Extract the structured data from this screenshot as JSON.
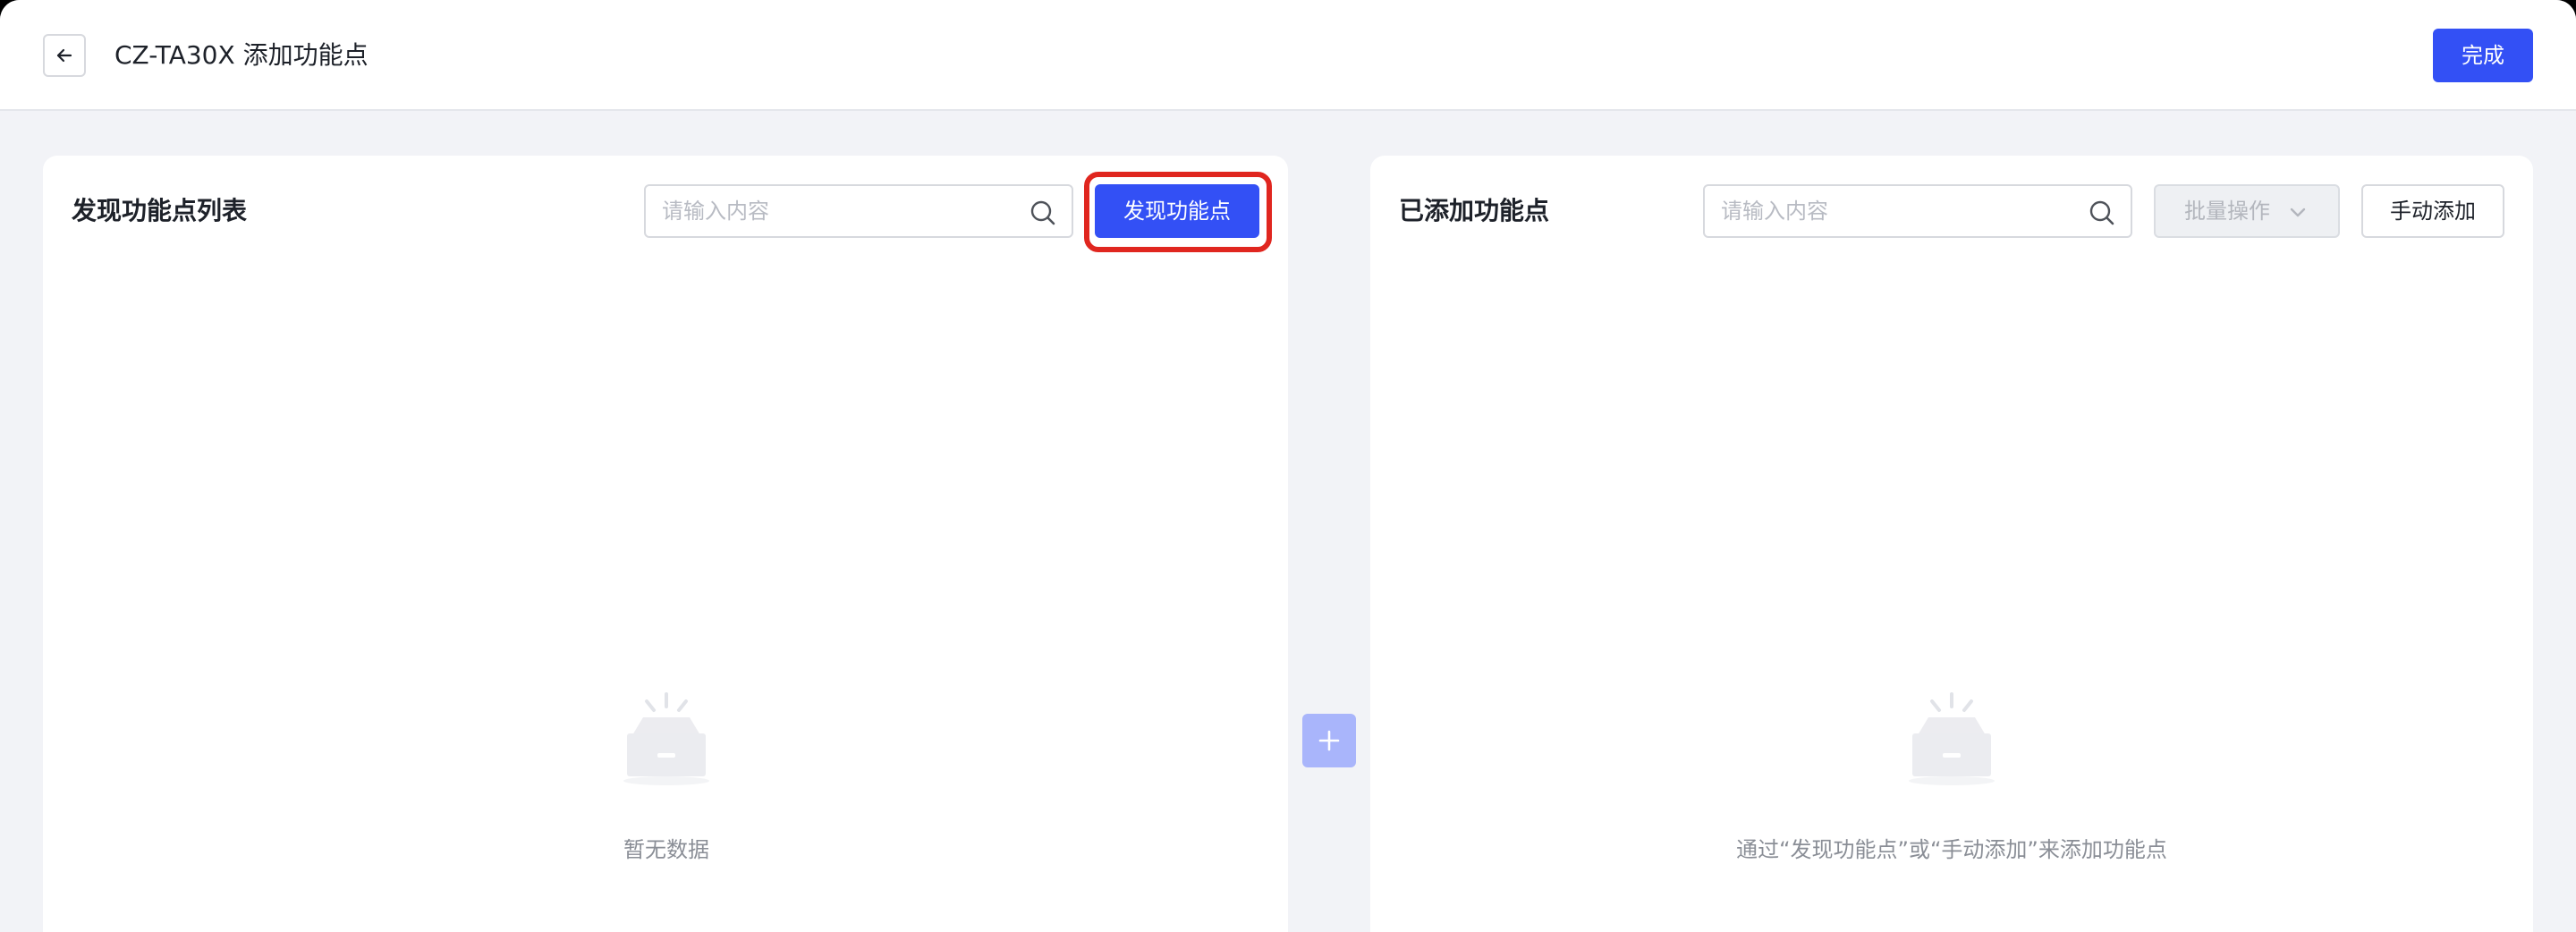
{
  "header": {
    "title": "CZ-TA30X 添加功能点",
    "back_icon": "arrow-left-icon",
    "done_label": "完成"
  },
  "discovered_panel": {
    "title": "发现功能点列表",
    "search_placeholder": "请输入内容",
    "discover_button_label": "发现功能点",
    "empty_text": "暂无数据"
  },
  "added_panel": {
    "title": "已添加功能点",
    "search_placeholder": "请输入内容",
    "batch_label": "批量操作",
    "batch_disabled": true,
    "manual_add_label": "手动添加",
    "empty_text": "通过“发现功能点”或“手动添加”来添加功能点"
  },
  "transfer": {
    "icon": "plus-icon",
    "disabled": true
  },
  "colors": {
    "primary": "#3350f5",
    "primary_disabled": "#a9b5fb",
    "highlight": "#e0261f",
    "page_bg": "#f2f3f7"
  }
}
